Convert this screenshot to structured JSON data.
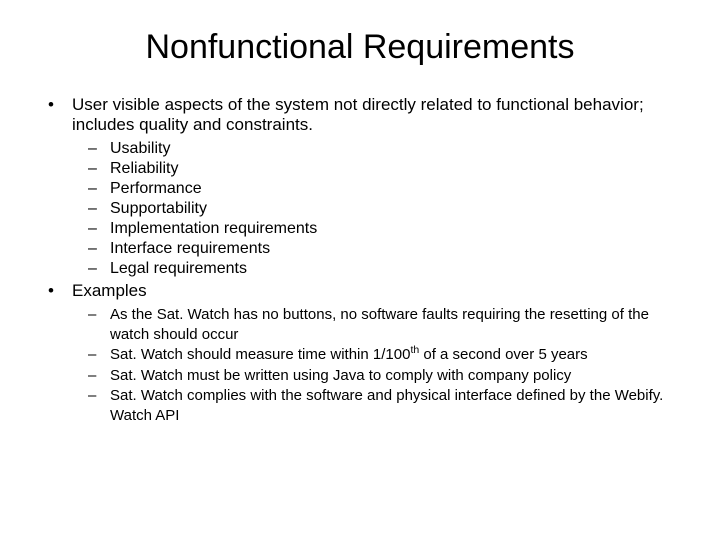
{
  "title": "Nonfunctional Requirements",
  "point1": {
    "text": "User visible aspects of the system not directly related to functional behavior; includes quality and constraints.",
    "subs": [
      "Usability",
      "Reliability",
      "Performance",
      "Supportability",
      "Implementation requirements",
      "Interface requirements",
      "Legal requirements"
    ]
  },
  "point2": {
    "text": "Examples",
    "subs": [
      "As the Sat. Watch has no buttons, no software faults requiring the resetting of the watch should occur",
      "Sat. Watch should measure time within 1/100 th of a second over 5 years",
      "Sat. Watch must be written using Java to comply with company policy",
      "Sat. Watch complies with the software and physical interface defined by the Webify. Watch API"
    ],
    "sub1_html": {
      "pre": "Sat. Watch should measure time within 1/100",
      "sup": "th",
      "post": " of a second over 5 years"
    }
  }
}
